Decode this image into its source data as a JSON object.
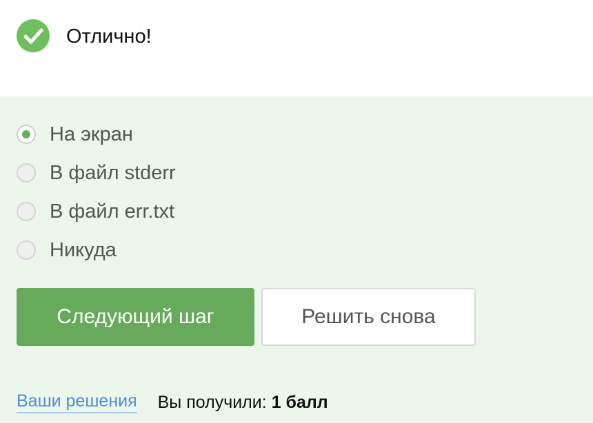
{
  "result": {
    "icon": "check-circle-icon",
    "message": "Отлично!",
    "color": "#6fbf5f"
  },
  "quiz": {
    "selected_index": 0,
    "options": [
      {
        "label": "На экран",
        "selected": true
      },
      {
        "label": "В файл stderr",
        "selected": false
      },
      {
        "label": "В файл err.txt",
        "selected": false
      },
      {
        "label": "Никуда",
        "selected": false
      }
    ]
  },
  "actions": {
    "next_label": "Следующий шаг",
    "retry_label": "Решить снова"
  },
  "footer": {
    "solutions_link": "Ваши решения",
    "score_label": "Вы получили:",
    "score_value": "1 балл"
  },
  "colors": {
    "panel_background": "#ecf6ea",
    "primary_button": "#67aa5c",
    "link": "#4a8fdc"
  }
}
